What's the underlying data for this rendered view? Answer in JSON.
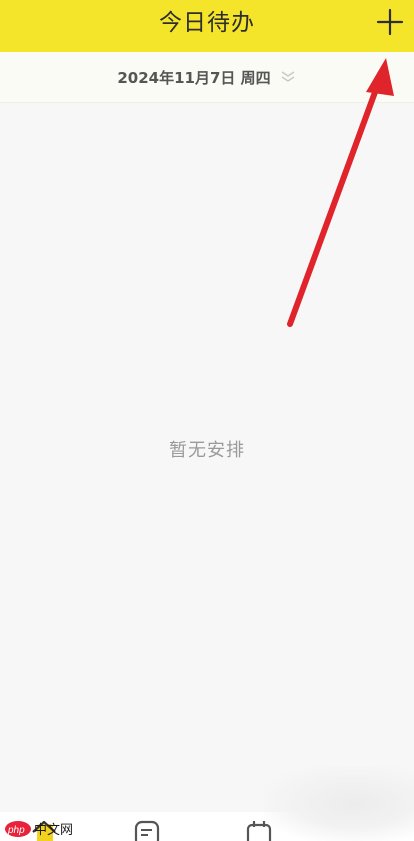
{
  "header": {
    "title": "今日待办",
    "add_icon": "plus-icon"
  },
  "date_bar": {
    "date_label": "2024年11月7日 周四",
    "expand_icon": "double-chevron-down-icon"
  },
  "main": {
    "empty_message": "暂无安排"
  },
  "tabbar": {
    "icons": [
      "home-icon",
      "notes-icon",
      "calendar-icon"
    ]
  },
  "watermark": {
    "logo": "php中文网"
  },
  "colors": {
    "header_bg": "#f5e52a",
    "page_bg": "#f7f7f7",
    "annotation_arrow": "#e0242b"
  }
}
